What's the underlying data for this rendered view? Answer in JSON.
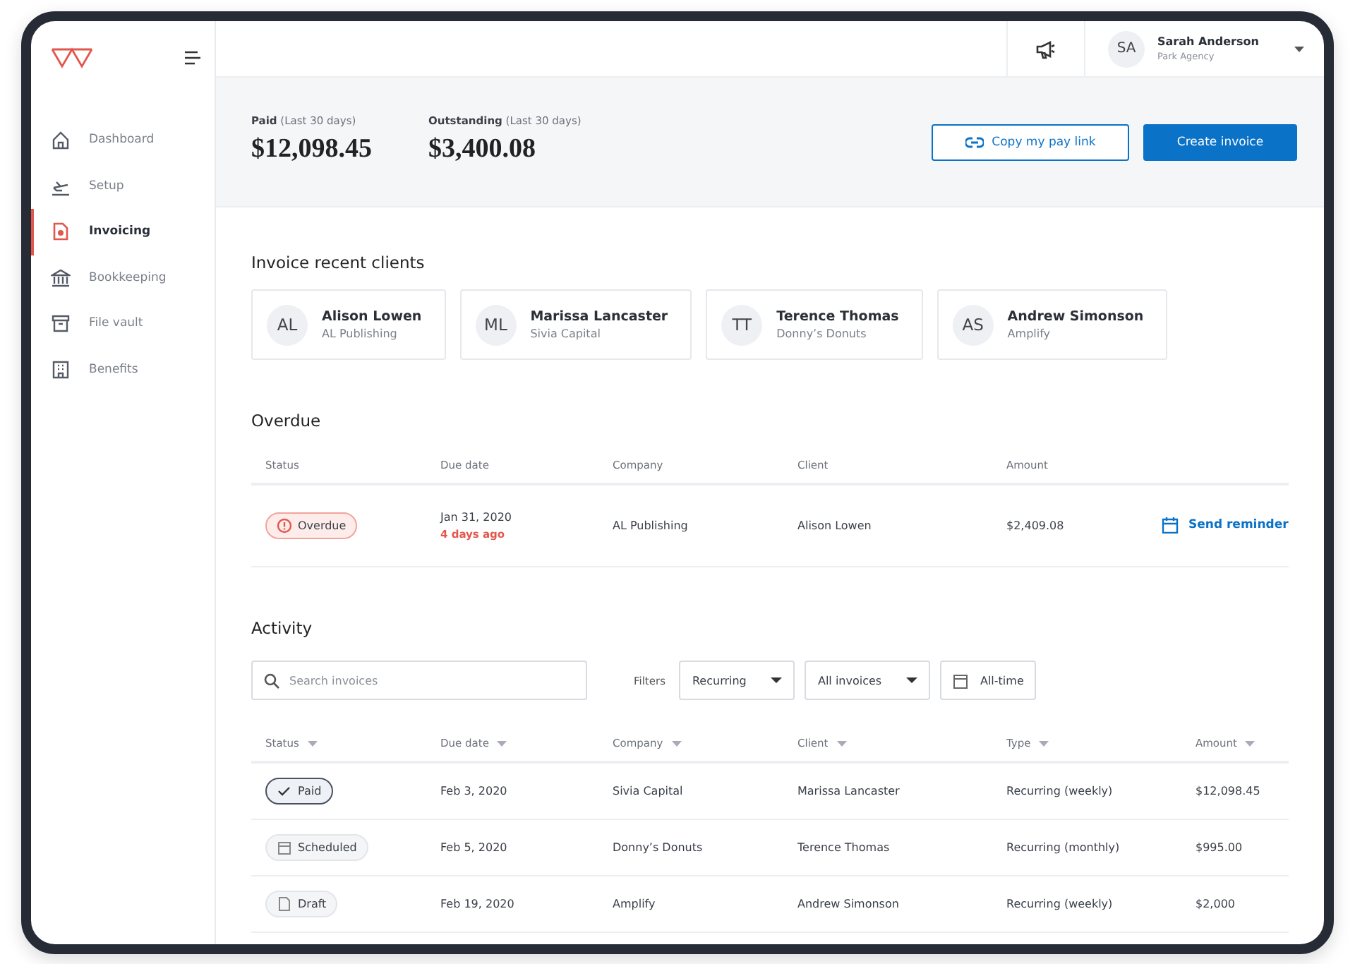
{
  "sidebar": {
    "items": [
      {
        "label": "Dashboard",
        "selected": false
      },
      {
        "label": "Setup",
        "selected": false
      },
      {
        "label": "Invoicing",
        "selected": true
      },
      {
        "label": "Bookkeeping",
        "selected": false
      },
      {
        "label": "File vault",
        "selected": false
      },
      {
        "label": "Benefits",
        "selected": false
      }
    ]
  },
  "topbar": {
    "user": {
      "initials": "SA",
      "name": "Sarah Anderson",
      "organization": "Park Agency"
    }
  },
  "summary": {
    "stats": [
      {
        "label": "Paid",
        "period": "(Last 30 days)",
        "value": "$12,098.45"
      },
      {
        "label": "Outstanding",
        "period": "(Last 30 days)",
        "value": "$3,400.08"
      }
    ],
    "buttons": [
      {
        "label": "Copy my pay link",
        "kind": "secondary"
      },
      {
        "label": "Create invoice",
        "kind": "primary"
      }
    ]
  },
  "recent_clients": {
    "title": "Invoice recent clients",
    "clients": [
      {
        "initials": "AL",
        "name": "Alison Lowen",
        "company": "AL Publishing"
      },
      {
        "initials": "ML",
        "name": "Marissa Lancaster",
        "company": "Sivia Capital"
      },
      {
        "initials": "TT",
        "name": "Terence Thomas",
        "company": "Donny’s Donuts"
      },
      {
        "initials": "AS",
        "name": "Andrew Simonson",
        "company": "Amplify"
      }
    ]
  },
  "overdue": {
    "title": "Overdue",
    "columns": [
      "Status",
      "Due date",
      "Company",
      "Client",
      "Amount"
    ],
    "rows": [
      {
        "status": "Overdue",
        "kind": "overdue",
        "due_date": "Jan 31, 2020",
        "due_note": "4 days ago",
        "company": "AL Publishing",
        "client": "Alison Lowen",
        "amount": "$2,409.08",
        "action": "Send reminder"
      }
    ]
  },
  "activity": {
    "title": "Activity",
    "search": {
      "placeholder": "Search invoices"
    },
    "filters_label": "Filters",
    "filters": [
      {
        "kind": "dropdown",
        "value": "Recurring"
      },
      {
        "kind": "dropdown",
        "value": "All invoices"
      },
      {
        "kind": "date",
        "value": "All-time"
      }
    ],
    "columns": [
      "Status",
      "Due date",
      "Company",
      "Client",
      "Type",
      "Amount"
    ],
    "rows": [
      {
        "status": "Paid",
        "kind": "paid",
        "due_date": "Feb 3, 2020",
        "company": "Sivia Capital",
        "client": "Marissa Lancaster",
        "type": "Recurring (weekly)",
        "amount": "$12,098.45"
      },
      {
        "status": "Scheduled",
        "kind": "scheduled",
        "due_date": "Feb 5, 2020",
        "company": "Donny’s Donuts",
        "client": "Terence Thomas",
        "type": "Recurring (monthly)",
        "amount": "$995.00"
      },
      {
        "status": "Draft",
        "kind": "draft",
        "due_date": "Feb 19, 2020",
        "company": "Amplify",
        "client": "Andrew Simonson",
        "type": "Recurring (weekly)",
        "amount": "$2,000"
      }
    ]
  }
}
